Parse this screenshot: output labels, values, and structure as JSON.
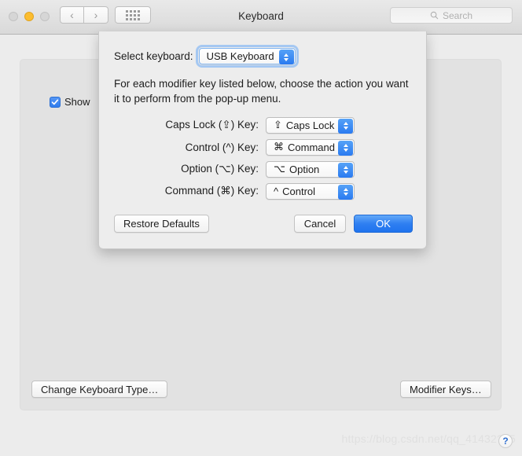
{
  "window": {
    "title": "Keyboard",
    "traffic_lights": [
      "close-button",
      "minimize-button",
      "zoom-button"
    ],
    "nav_back_glyph": "‹",
    "nav_forward_glyph": "›",
    "show_all_icon": "grid-icon",
    "search": {
      "placeholder": "Search",
      "icon": "search-icon",
      "value": ""
    }
  },
  "main": {
    "show_checkbox": {
      "label": "Show",
      "checked": true
    },
    "change_keyboard_type_label": "Change Keyboard Type…",
    "modifier_keys_label": "Modifier Keys…",
    "help_label": "?",
    "watermark": "https://blog.csdn.net/qq_41432?45"
  },
  "sheet": {
    "select_keyboard_label": "Select keyboard:",
    "selected_keyboard": "USB Keyboard",
    "description": "For each modifier key listed below, choose the action you want it to perform from the pop-up menu.",
    "rows": [
      {
        "label": "Caps Lock (⇪) Key:",
        "glyph": "⇪",
        "value": "Caps Lock"
      },
      {
        "label": "Control (^) Key:",
        "glyph": "⌘",
        "value": "Command"
      },
      {
        "label": "Option (⌥) Key:",
        "glyph": "⌥",
        "value": "Option"
      },
      {
        "label": "Command (⌘) Key:",
        "glyph": "^",
        "value": "Control"
      }
    ],
    "restore_label": "Restore Defaults",
    "cancel_label": "Cancel",
    "ok_label": "OK"
  },
  "colors": {
    "accent_blue": "#2f7ff1",
    "window_bg": "#ececec",
    "panel_bg": "#e2e2e2",
    "sheet_bg": "#ededed",
    "minimize_yellow": "#fcbd2f"
  }
}
